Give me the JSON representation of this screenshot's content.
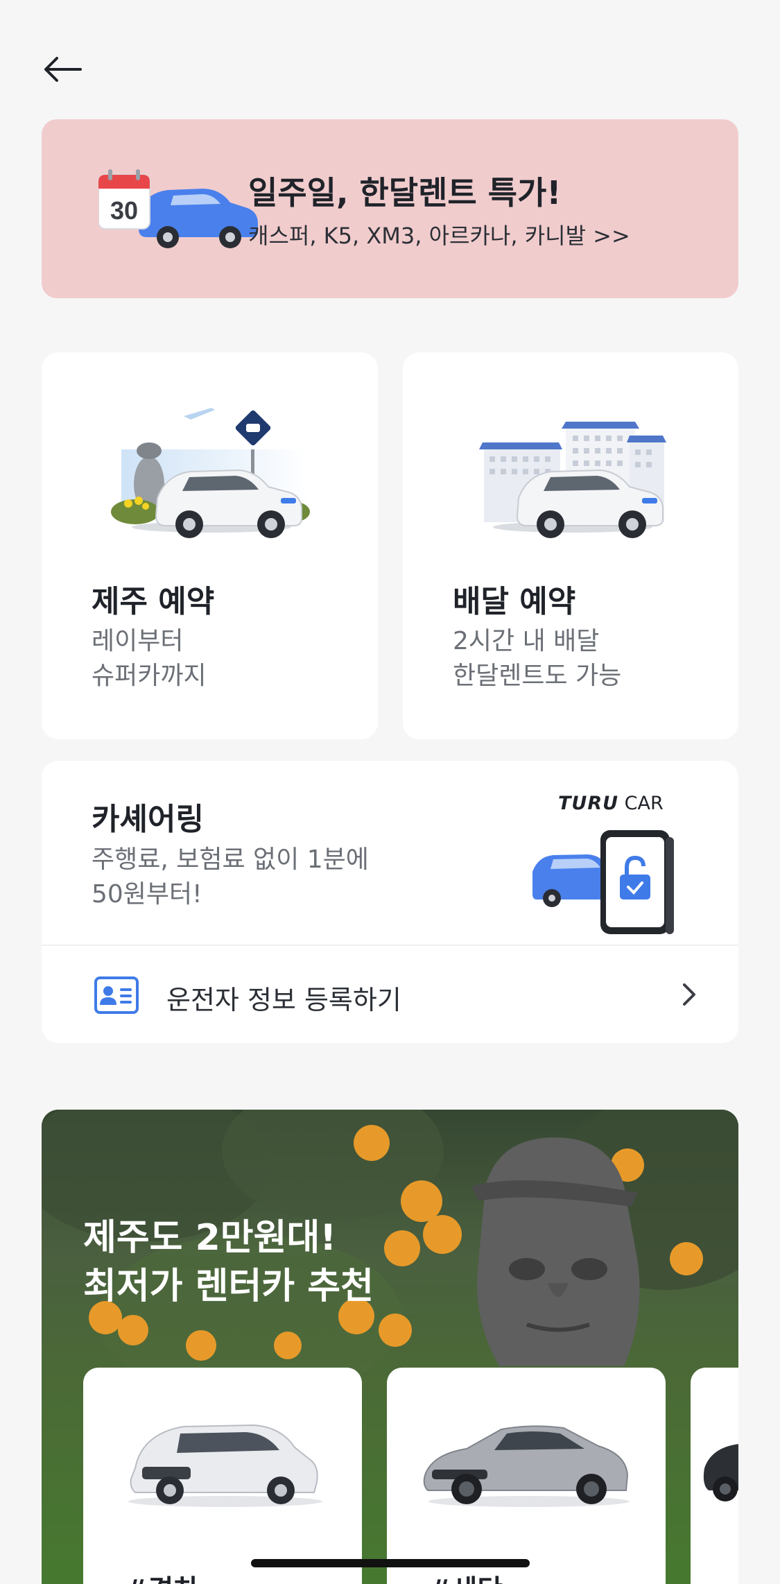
{
  "header": {
    "back_icon": "arrow-left-icon"
  },
  "promo_banner": {
    "badge_number": "30",
    "title": "일주일, 한달렌트 특가!",
    "subtitle": "캐스퍼, K5, XM3, 아르카나, 카니발 >>",
    "background_color": "#f1cccd"
  },
  "cards": {
    "jeju": {
      "title": "제주 예약",
      "desc_line1": "레이부터",
      "desc_line2": "슈퍼카까지"
    },
    "delivery": {
      "title": "배달 예약",
      "desc_line1": "2시간 내 배달",
      "desc_line2": "한달렌트도 가능"
    }
  },
  "carsharing": {
    "title": "카셰어링",
    "desc_line1": "주행료, 보험료 없이 1분에",
    "desc_line2": "50원부터!",
    "logo_brand": "TURU",
    "logo_suffix": "CAR",
    "driver_register_label": "운전자 정보 등록하기",
    "driver_icon": "id-card-icon",
    "chevron_icon": "chevron-right-icon"
  },
  "jeju_recommend": {
    "title_line1": "제주도 2만원대!",
    "title_line2": "최저가 렌터카 추천",
    "items": [
      {
        "tag": "#경차"
      },
      {
        "tag": "#세단"
      },
      {
        "tag": ""
      }
    ]
  },
  "colors": {
    "accent_blue": "#3f7be8",
    "text_primary": "#1f2329",
    "text_secondary": "#6b6f76"
  }
}
